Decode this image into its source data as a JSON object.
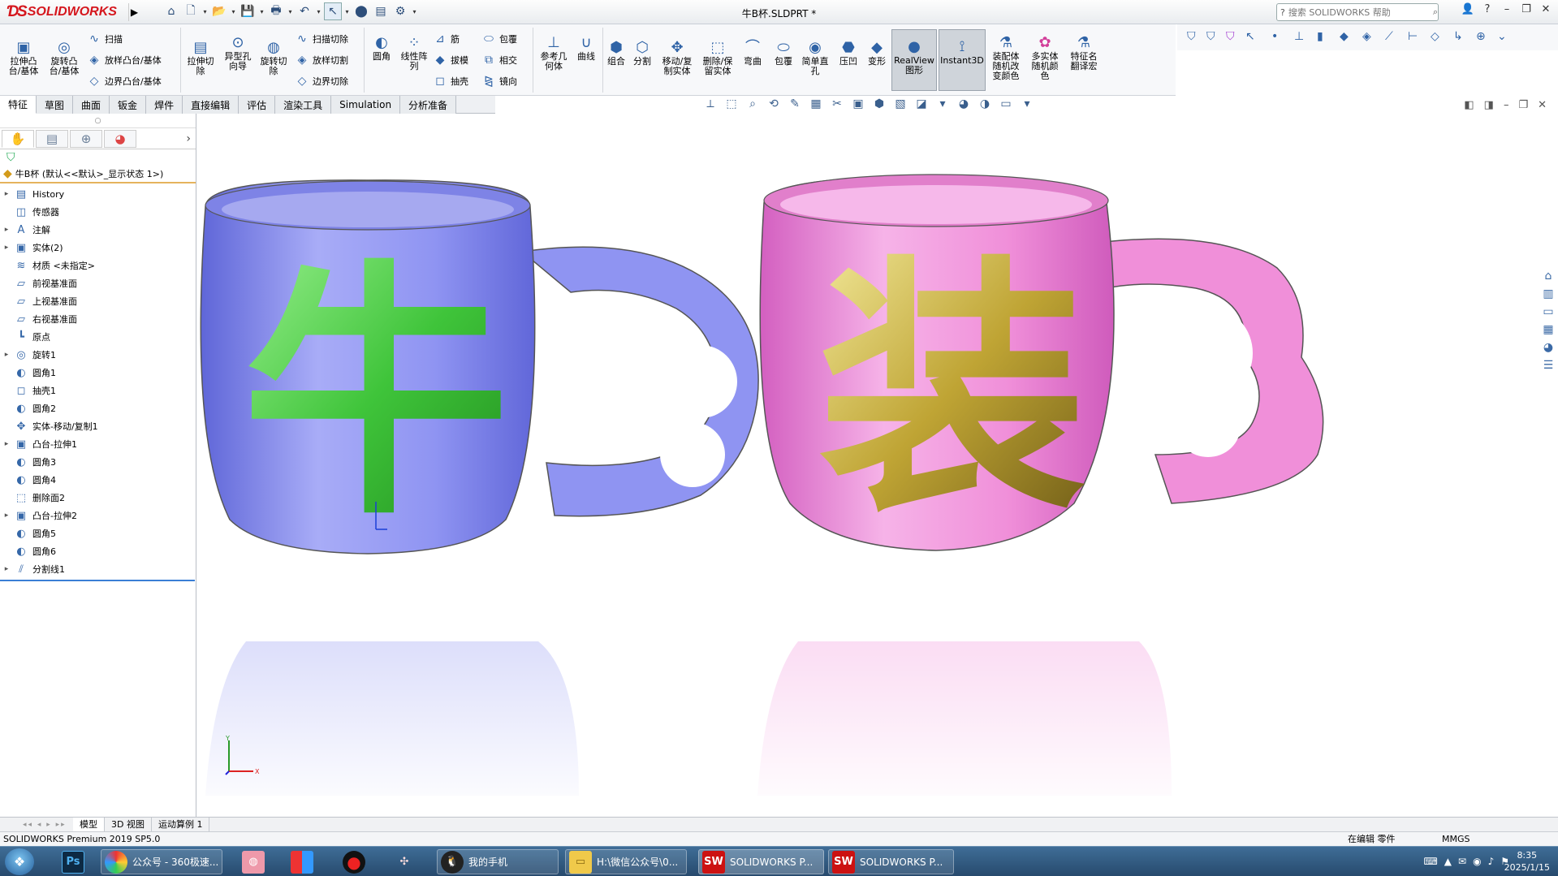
{
  "app": {
    "brand": "SOLIDWORKS",
    "document_title": "牛B杯.SLDPRT *",
    "search_placeholder": "搜索 SOLIDWORKS 帮助"
  },
  "quick_access": [
    "home-icon",
    "new-icon",
    "open-icon",
    "save-icon",
    "print-icon",
    "undo-icon",
    "select-icon",
    "traffic-light-icon",
    "file-props-icon",
    "options-icon"
  ],
  "ribbon": {
    "extrude_boss": "拉伸凸\n台/基体",
    "revolve_boss": "旋转凸\n台/基体",
    "sweep": "扫描",
    "loft_boss": "放样凸台/基体",
    "boundary_boss": "边界凸台/基体",
    "extrude_cut": "拉伸切\n除",
    "hole_wizard": "异型孔\n向导",
    "revolve_cut": "旋转切\n除",
    "swept_cut": "扫描切除",
    "lofted_cut": "放样切割",
    "boundary_cut": "边界切除",
    "fillet": "圆角",
    "linear_pattern": "线性阵\n列",
    "rib": "筋",
    "draft": "拔模",
    "shell": "抽壳",
    "wrap": "包覆",
    "intersect": "相交",
    "mirror": "镜向",
    "ref_geometry": "参考几\n何体",
    "curves": "曲线",
    "combine": "组合",
    "split": "分割",
    "move_copy": "移动/复\n制实体",
    "delete_keep": "删除/保\n留实体",
    "flex": "弯曲",
    "wrap2": "包覆",
    "simple_hole": "简单直\n孔",
    "indent": "压凹",
    "deform": "变形",
    "realview": "RealView\n图形",
    "instant3d": "Instant3D",
    "asm_color": "装配体\n随机改\n变颜色",
    "multibody_color": "多实体\n随机颜\n色",
    "feature_name": "特征名\n翻译宏"
  },
  "tabs": [
    "特征",
    "草图",
    "曲面",
    "钣金",
    "焊件",
    "直接编辑",
    "评估",
    "渲染工具",
    "Simulation",
    "分析准备"
  ],
  "active_tab": "特征",
  "tree": {
    "root": "牛B杯 (默认<<默认>_显示状态 1>)",
    "items": [
      {
        "label": "History",
        "icon": "history-icon",
        "expandable": true
      },
      {
        "label": "传感器",
        "icon": "sensor-icon",
        "expandable": false
      },
      {
        "label": "注解",
        "icon": "annotation-icon",
        "expandable": true
      },
      {
        "label": "实体(2)",
        "icon": "solid-bodies-icon",
        "expandable": true
      },
      {
        "label": "材质 <未指定>",
        "icon": "material-icon",
        "expandable": false
      },
      {
        "label": "前视基准面",
        "icon": "plane-icon",
        "expandable": false
      },
      {
        "label": "上视基准面",
        "icon": "plane-icon",
        "expandable": false
      },
      {
        "label": "右视基准面",
        "icon": "plane-icon",
        "expandable": false
      },
      {
        "label": "原点",
        "icon": "origin-icon",
        "expandable": false
      },
      {
        "label": "旋转1",
        "icon": "revolve-icon",
        "expandable": true
      },
      {
        "label": "圆角1",
        "icon": "fillet-icon",
        "expandable": false
      },
      {
        "label": "抽壳1",
        "icon": "shell-icon",
        "expandable": false
      },
      {
        "label": "圆角2",
        "icon": "fillet-icon",
        "expandable": false
      },
      {
        "label": "实体-移动/复制1",
        "icon": "move-copy-icon",
        "expandable": false
      },
      {
        "label": "凸台-拉伸1",
        "icon": "extrude-icon",
        "expandable": true
      },
      {
        "label": "圆角3",
        "icon": "fillet-icon",
        "expandable": false
      },
      {
        "label": "圆角4",
        "icon": "fillet-icon",
        "expandable": false
      },
      {
        "label": "删除面2",
        "icon": "delete-face-icon",
        "expandable": false
      },
      {
        "label": "凸台-拉伸2",
        "icon": "extrude-icon",
        "expandable": true
      },
      {
        "label": "圆角5",
        "icon": "fillet-icon",
        "expandable": false
      },
      {
        "label": "圆角6",
        "icon": "fillet-icon",
        "expandable": false
      },
      {
        "label": "分割线1",
        "icon": "split-line-icon",
        "expandable": true
      }
    ]
  },
  "scene": {
    "left_glyph": "牛",
    "right_glyph": "装",
    "mug_colors": {
      "left": "#8f94f2",
      "right": "#f08fd9",
      "left_insert": "#4fd44a",
      "right_insert": "#c8b23a"
    }
  },
  "bottom_tabs": [
    "模型",
    "3D 视图",
    "运动算例 1"
  ],
  "status": {
    "left": "SOLIDWORKS Premium 2019 SP5.0",
    "edit": "在编辑 零件",
    "units": "MMGS"
  },
  "taskbar": {
    "items": [
      {
        "label": "",
        "icon": "photoshop-icon"
      },
      {
        "label": "公众号 - 360极速...",
        "icon": "browser-icon"
      },
      {
        "label": "",
        "icon": "app-icon"
      },
      {
        "label": "",
        "icon": "colorful-app-icon"
      },
      {
        "label": "",
        "icon": "recorder-icon"
      },
      {
        "label": "",
        "icon": "fan-icon"
      },
      {
        "label": "我的手机",
        "icon": "qq-icon"
      },
      {
        "label": "H:\\微信公众号\\0...",
        "icon": "folder-icon"
      },
      {
        "label": "SOLIDWORKS P...",
        "icon": "solidworks-icon"
      },
      {
        "label": "SOLIDWORKS P...",
        "icon": "solidworks-icon"
      }
    ],
    "sw_year": "2019",
    "time": "8:35",
    "date": "2025/1/15"
  }
}
